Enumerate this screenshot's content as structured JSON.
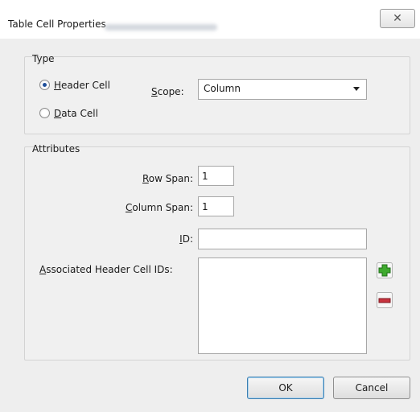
{
  "window": {
    "title": "Table Cell Properties",
    "close_glyph": "✕"
  },
  "type_group": {
    "legend": "Type",
    "header_cell": {
      "accel": "H",
      "rest": "eader Cell",
      "checked": true
    },
    "data_cell": {
      "accel": "D",
      "rest": "ata Cell",
      "checked": false
    },
    "scope": {
      "accel": "S",
      "rest": "cope:",
      "value": "Column"
    }
  },
  "attributes_group": {
    "legend": "Attributes",
    "row_span": {
      "accel": "R",
      "rest": "ow Span:",
      "value": "1"
    },
    "column_span": {
      "accel": "C",
      "rest": "olumn Span:",
      "value": "1"
    },
    "id": {
      "accel": "I",
      "rest": "D:",
      "value": ""
    },
    "associated": {
      "accel": "A",
      "rest": "ssociated Header Cell IDs:"
    }
  },
  "buttons": {
    "ok": "OK",
    "cancel": "Cancel"
  },
  "colors": {
    "plus": "#3faa2e",
    "minus": "#c8343f"
  },
  "icons": [
    "close-icon",
    "plus-icon",
    "minus-icon"
  ]
}
